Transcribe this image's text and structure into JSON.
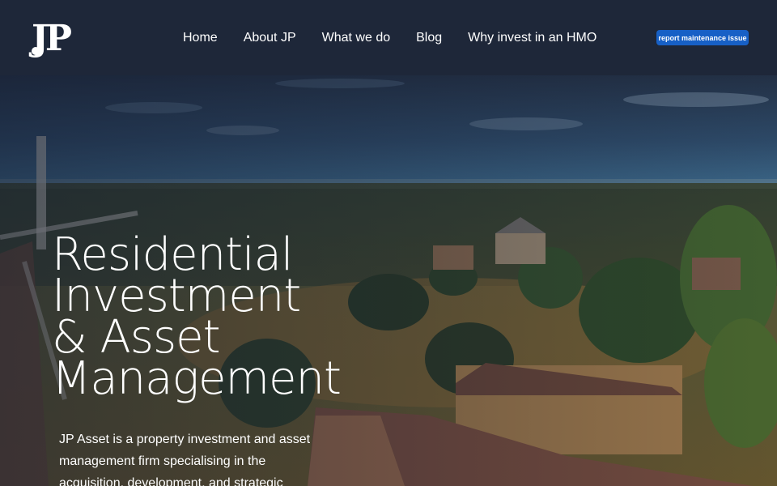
{
  "brand": {
    "logo_text": "JP"
  },
  "nav": {
    "items": [
      {
        "label": "Home"
      },
      {
        "label": "About JP"
      },
      {
        "label": "What we do"
      },
      {
        "label": "Blog"
      },
      {
        "label": "Why invest in an HMO"
      }
    ]
  },
  "header": {
    "report_button": "report maintenance issue"
  },
  "hero": {
    "title_lines": [
      "Residential",
      "Investment",
      "& Asset",
      "Management"
    ],
    "description": "JP Asset is a property investment and asset management firm specialising in the acquisition, development, and strategic"
  },
  "colors": {
    "header_bg": "#1e2739",
    "button_bg": "#1760c6",
    "text": "#ffffff"
  },
  "icons": {
    "logo": "jp-monogram-logo"
  }
}
